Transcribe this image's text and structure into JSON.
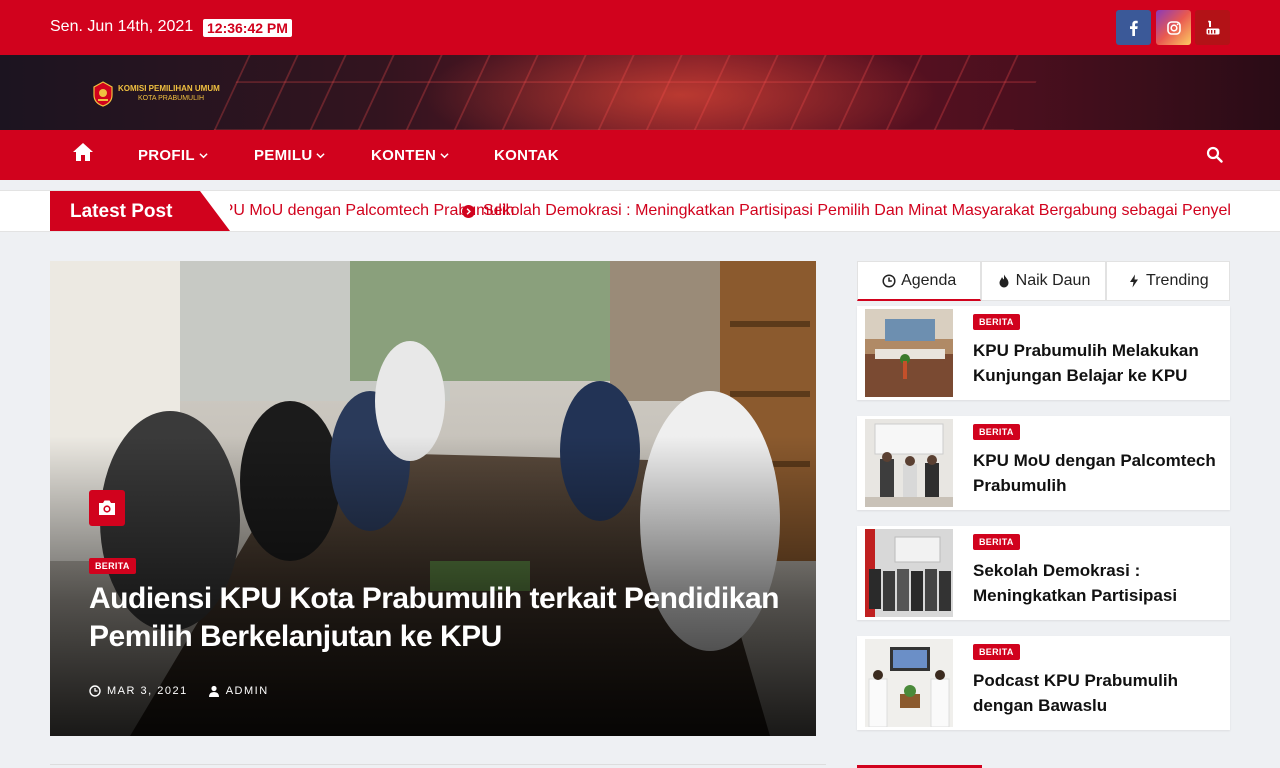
{
  "topbar": {
    "date": "Sen. Jun 14th, 2021",
    "time": "12:36:42 PM",
    "social": [
      {
        "icon": "facebook-icon",
        "color": "#3b5998"
      },
      {
        "icon": "instagram-icon",
        "color": "#c13584"
      },
      {
        "icon": "youtube-icon",
        "color": "#b31217"
      }
    ]
  },
  "brand": {
    "logo_line1": "KOMISI PEMILIHAN UMUM",
    "logo_line2": "KOTA PRABUMULIH"
  },
  "nav": {
    "items": [
      {
        "label": "PROFIL",
        "dropdown": true
      },
      {
        "label": "PEMILU",
        "dropdown": true
      },
      {
        "label": "KONTEN",
        "dropdown": true
      },
      {
        "label": "KONTAK",
        "dropdown": false
      }
    ]
  },
  "ticker": {
    "label": "Latest Post",
    "items": [
      "KPU MoU dengan Palcomtech Prabumulih",
      "Sekolah Demokrasi : Meningkatkan Partisipasi Pemilih Dan Minat Masyarakat Bergabung sebagai Penyelenggara"
    ]
  },
  "featured": {
    "category": "BERITA",
    "title": "Audiensi KPU Kota Prabumulih terkait Pendidikan Pemilih Berkelanjutan ke KPU",
    "date": "MAR 3, 2021",
    "author": "ADMIN"
  },
  "sidebar": {
    "tabs": [
      {
        "label": "Agenda",
        "icon": "clock-icon",
        "active": true
      },
      {
        "label": "Naik Daun",
        "icon": "fire-icon",
        "active": false
      },
      {
        "label": "Trending",
        "icon": "bolt-icon",
        "active": false
      }
    ],
    "posts": [
      {
        "category": "BERITA",
        "title": "KPU Prabumulih Melakukan Kunjungan Belajar ke KPU"
      },
      {
        "category": "BERITA",
        "title": "KPU MoU dengan Palcomtech Prabumulih"
      },
      {
        "category": "BERITA",
        "title": "Sekolah Demokrasi : Meningkatkan Partisipasi"
      },
      {
        "category": "BERITA",
        "title": "Podcast KPU Prabumulih dengan Bawaslu"
      }
    ]
  },
  "colors": {
    "brand_red": "#d1021d"
  }
}
